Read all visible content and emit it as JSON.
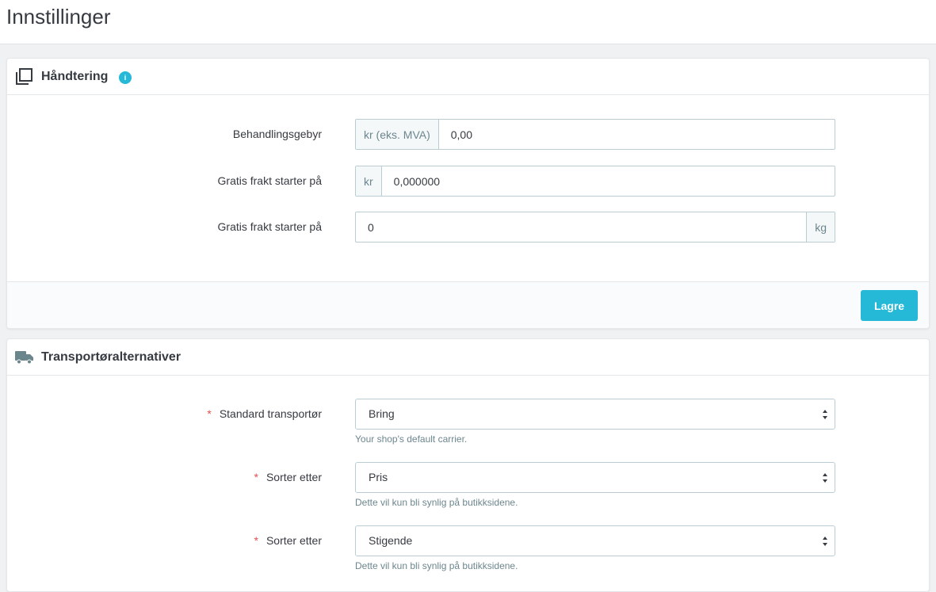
{
  "page": {
    "title": "Innstillinger"
  },
  "handling_panel": {
    "title": "Håndtering",
    "info_icon": "info-icon",
    "fields": [
      {
        "label": "Behandlingsgebyr",
        "prefix": "kr (eks. MVA)",
        "value": "0,00"
      },
      {
        "label": "Gratis frakt starter på",
        "prefix": "kr",
        "value": "0,000000"
      },
      {
        "label": "Gratis frakt starter på",
        "suffix": "kg",
        "value": "0"
      }
    ],
    "save_label": "Lagre"
  },
  "carrier_panel": {
    "title": "Transportøralternativer",
    "fields": [
      {
        "label": "Standard transportør",
        "value": "Bring",
        "help": "Your shop's default carrier."
      },
      {
        "label": "Sorter etter",
        "value": "Pris",
        "help": "Dette vil kun bli synlig på butikksidene."
      },
      {
        "label": "Sorter etter",
        "value": "Stigende",
        "help": "Dette vil kun bli synlig på butikksidene."
      }
    ]
  },
  "required_mark": "*",
  "colors": {
    "accent": "#25b9d7",
    "required": "#e0504f",
    "text": "#363a41",
    "muted": "#6c868e"
  }
}
